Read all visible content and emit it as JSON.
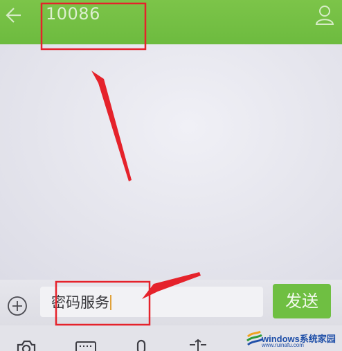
{
  "header": {
    "title": "10086",
    "back_icon": "arrow-left-icon",
    "profile_icon": "person-icon"
  },
  "composer": {
    "add_icon": "plus-circle-icon",
    "message_value": "密码服务",
    "send_label": "发送"
  },
  "toolbar": {
    "icons": [
      "camera-icon",
      "keyboard-icon",
      "microphone-icon",
      "text-cursor-icon"
    ]
  },
  "watermark": {
    "brand": "windows系统家园",
    "url": "www.ruinafu.com"
  },
  "colors": {
    "header_bg": "#6dbb3f",
    "send_bg": "#6fbf42",
    "annotation_red": "#e5222b"
  }
}
